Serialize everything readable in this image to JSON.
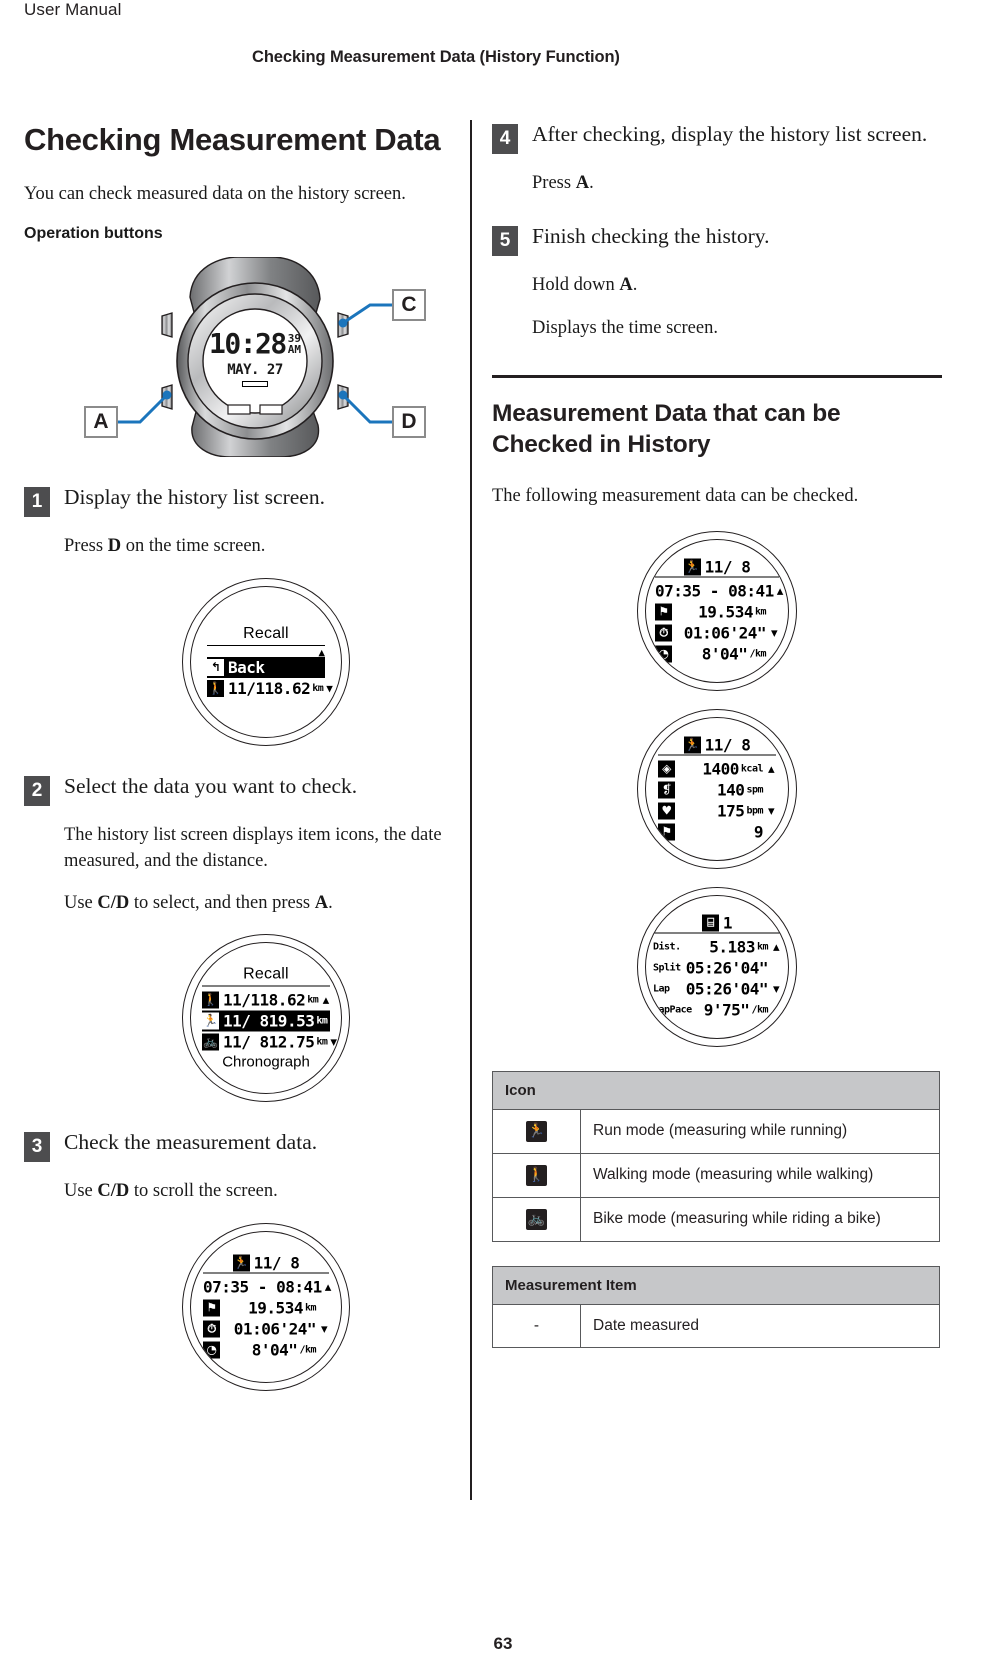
{
  "running_head": {
    "left": "User Manual",
    "right": "Checking Measurement Data (History Function)"
  },
  "page_number": "63",
  "left_column": {
    "title": "Checking Measurement Data",
    "intro": "You can check measured data on the history screen.",
    "operation_buttons_label": "Operation buttons",
    "watch_figure": {
      "callouts": [
        "C",
        "A",
        "D"
      ],
      "time_screen": {
        "time": "10:28",
        "seconds": "39",
        "meridiem": "AM",
        "date": "MAY. 27"
      }
    },
    "steps": [
      {
        "num": "1",
        "heading": "Display the history list screen.",
        "body_pre": "Press ",
        "body_key": "D",
        "body_post": " on the time screen.",
        "screen": {
          "title": "Recall",
          "rows": [
            {
              "icon": "back-arrow",
              "label": "Back",
              "value": "",
              "unit": "",
              "arrow": "▲",
              "selected": true
            },
            {
              "icon": "walk",
              "label": "11/11",
              "value": "8.62",
              "unit": "km",
              "arrow": "▼",
              "selected": false
            }
          ]
        }
      },
      {
        "num": "2",
        "heading": "Select the data you want to check.",
        "body1": "The history list screen displays item icons, the date measured, and the distance.",
        "body2_pre": "Use ",
        "body2_key1": "C/D",
        "body2_mid": " to select, and then press ",
        "body2_key2": "A",
        "body2_post": ".",
        "screen": {
          "title": "Recall",
          "rows": [
            {
              "icon": "walk",
              "label": "11/11",
              "value": "8.62",
              "unit": "km",
              "arrow": "▲",
              "selected": false
            },
            {
              "icon": "run",
              "label": "11/ 8",
              "value": "19.53",
              "unit": "km",
              "arrow": "",
              "selected": true
            },
            {
              "icon": "bike",
              "label": "11/ 8",
              "value": "12.75",
              "unit": "km",
              "arrow": "▼",
              "selected": false
            }
          ],
          "footer": "Chronograph"
        }
      },
      {
        "num": "3",
        "heading": "Check the measurement data.",
        "body_pre": "Use ",
        "body_key": "C/D",
        "body_post": " to scroll the screen."
      }
    ]
  },
  "right_column": {
    "steps": [
      {
        "num": "4",
        "heading": "After checking, display the history list screen.",
        "body_pre": "Press ",
        "body_key": "A",
        "body_post": "."
      },
      {
        "num": "5",
        "heading": "Finish checking the history.",
        "body1_pre": "Hold down ",
        "body1_key": "A",
        "body1_post": ".",
        "body2": "Displays the time screen."
      }
    ],
    "section2_title": "Measurement Data that can be Checked in History",
    "section2_intro": "The following measurement data can be checked.",
    "icon_table": {
      "header": "Icon",
      "rows": [
        {
          "icon": "run",
          "description": "Run mode (measuring while running)"
        },
        {
          "icon": "walk",
          "description": "Walking mode (measuring while walking)"
        },
        {
          "icon": "bike",
          "description": "Bike mode (measuring while riding a bike)"
        }
      ]
    },
    "item_table": {
      "header": "Measurement Item",
      "rows": [
        {
          "icon": "-",
          "description": "Date measured"
        }
      ]
    }
  },
  "detail_screens": [
    {
      "name": "detail-screen-1",
      "header_icon": "run",
      "header_date": "11/ 8",
      "rows": [
        {
          "icon": "",
          "value": "07:35 - 08:41",
          "unit": "",
          "arrow": "▲",
          "center": true
        },
        {
          "icon": "flag",
          "value": "19.534",
          "unit": "km",
          "arrow": ""
        },
        {
          "icon": "stopwatch",
          "value": "01:06'24\"",
          "unit": "",
          "arrow": "▼"
        },
        {
          "icon": "gauge",
          "value": "8'04\"",
          "unit": "/km",
          "arrow": ""
        }
      ]
    },
    {
      "name": "detail-screen-2",
      "header_icon": "run",
      "header_date": "11/ 8",
      "rows": [
        {
          "icon": "flame",
          "value": "1400",
          "unit": "kcal",
          "arrow": "▲"
        },
        {
          "icon": "steps",
          "value": "140",
          "unit": "spm",
          "arrow": ""
        },
        {
          "icon": "heart",
          "value": "175",
          "unit": "bpm",
          "arrow": "▼"
        },
        {
          "icon": "flag",
          "value": "9",
          "unit": "",
          "arrow": ""
        }
      ]
    },
    {
      "name": "detail-screen-3",
      "header_icon": "lap",
      "header_date": "1",
      "rows": [
        {
          "icon": "",
          "label": "Dist.",
          "value": "5.183",
          "unit": "km",
          "arrow": "▲"
        },
        {
          "icon": "",
          "label": "Split",
          "value": "05:26'04\"",
          "unit": "",
          "arrow": ""
        },
        {
          "icon": "",
          "label": "Lap",
          "value": "05:26'04\"",
          "unit": "",
          "arrow": "▼"
        },
        {
          "icon": "",
          "label": "LapPace",
          "value": "9'75\"",
          "unit": "/km",
          "arrow": ""
        }
      ]
    }
  ],
  "step3_screen": {
    "header_icon": "run",
    "header_date": "11/ 8",
    "rows": [
      {
        "icon": "",
        "value": "07:35 - 08:41",
        "unit": "",
        "arrow": "▲",
        "center": true
      },
      {
        "icon": "flag",
        "value": "19.534",
        "unit": "km",
        "arrow": ""
      },
      {
        "icon": "stopwatch",
        "value": "01:06'24\"",
        "unit": "",
        "arrow": "▼"
      },
      {
        "icon": "gauge",
        "value": "8'04\"",
        "unit": "/km",
        "arrow": ""
      }
    ]
  }
}
